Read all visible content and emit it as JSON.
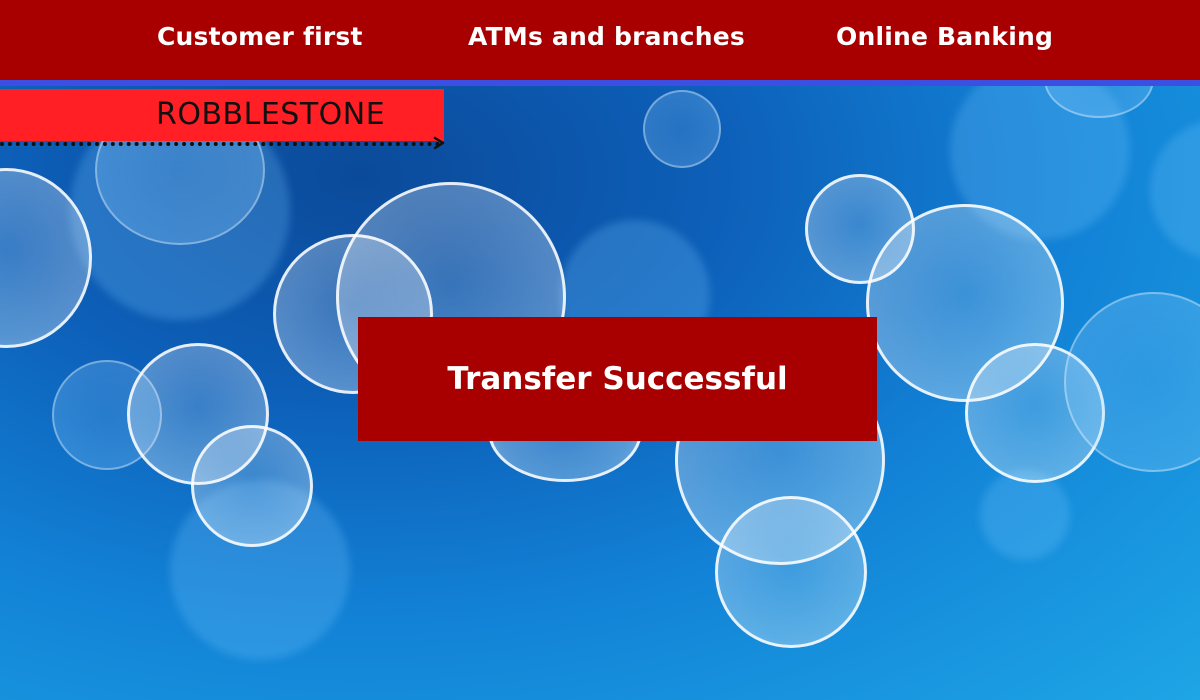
{
  "nav": {
    "items": [
      {
        "label": "Customer first"
      },
      {
        "label": "ATMs and branches"
      },
      {
        "label": "Online Banking"
      }
    ]
  },
  "brand": {
    "name": "ROBBLESTONE"
  },
  "banner": {
    "message": "Transfer Successful"
  },
  "colors": {
    "primary_red": "#a80000",
    "brand_red": "#ff1f24",
    "nav_underline": "#3d4fe0",
    "background_blue": "#1282d6"
  },
  "icons": {
    "brand_arrow": "arrow-right-icon"
  }
}
